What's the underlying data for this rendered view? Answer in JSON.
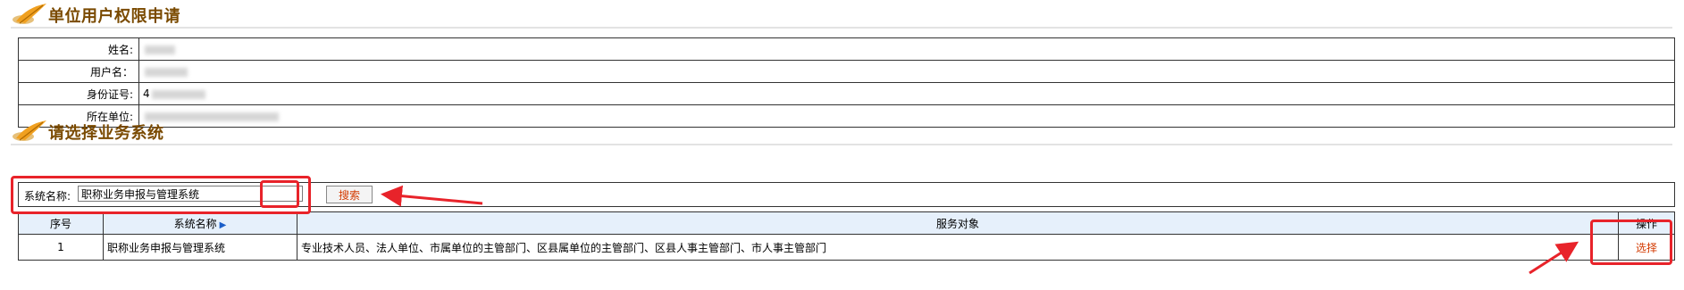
{
  "section1": {
    "title": "单位用户权限申请"
  },
  "user_info": [
    {
      "label": "姓名:",
      "value": ""
    },
    {
      "label": "用户名：",
      "value": ""
    },
    {
      "label": "身份证号:",
      "value": "4"
    },
    {
      "label": "所在单位:",
      "value": ""
    }
  ],
  "section2": {
    "title": "请选择业务系统"
  },
  "search": {
    "label": "系统名称:",
    "value": "职称业务申报与管理系统",
    "button": "搜索"
  },
  "grid": {
    "headers": {
      "index": "序号",
      "name": "系统名称",
      "target": "服务对象",
      "action": "操作"
    },
    "rows": [
      {
        "index": "1",
        "name": "职称业务申报与管理系统",
        "target": "专业技术人员、法人单位、市属单位的主管部门、区县属单位的主管部门、区县人事主管部门、市人事主管部门",
        "action": "选择"
      }
    ]
  },
  "colors": {
    "accent": "#d33a00",
    "title": "#7a4a00",
    "annotation": "#e8232a",
    "header_bg": "#e6f0fb"
  },
  "icons": [
    "quill-logo-icon",
    "sort-arrow-icon"
  ]
}
